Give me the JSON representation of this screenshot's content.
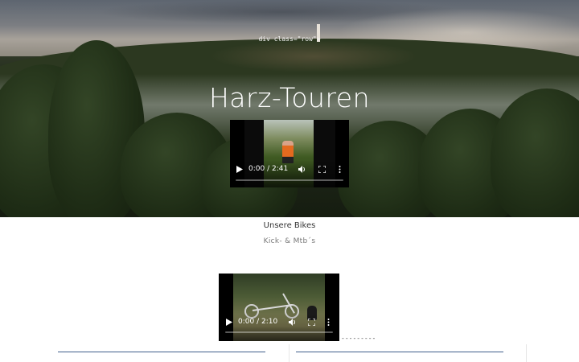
{
  "hero": {
    "note": "div class=\"row\">",
    "title": "Harz-Touren"
  },
  "videos": [
    {
      "time": "0:00 / 2:41",
      "progress": 0
    },
    {
      "time": "0:00 / 2:10",
      "progress": 0
    }
  ],
  "section": {
    "title": "Unsere Bikes",
    "subtitle": "Kick- & Mtb´s"
  },
  "separator_text": "---------",
  "icons": {
    "play": "play-icon",
    "volume": "volume-icon",
    "fullscreen": "fullscreen-icon",
    "more": "more-vertical-icon"
  }
}
